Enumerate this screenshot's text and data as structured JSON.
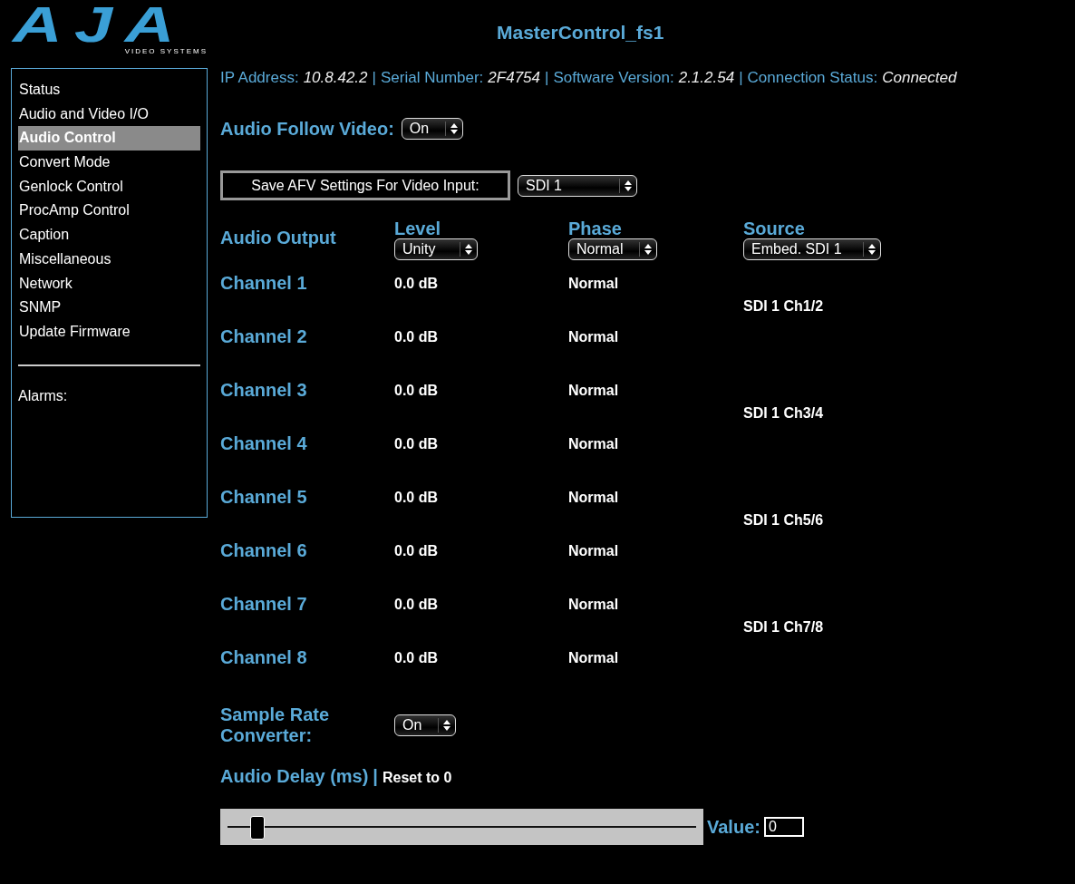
{
  "logo": {
    "mark": "AJA",
    "tagline": "VIDEO SYSTEMS"
  },
  "title": "MasterControl_fs1",
  "sidebar": {
    "items": [
      {
        "label": "Status",
        "selected": false
      },
      {
        "label": "Audio and Video I/O",
        "selected": false
      },
      {
        "label": "Audio Control",
        "selected": true
      },
      {
        "label": "Convert Mode",
        "selected": false
      },
      {
        "label": "Genlock Control",
        "selected": false
      },
      {
        "label": "ProcAmp Control",
        "selected": false
      },
      {
        "label": "Caption",
        "selected": false
      },
      {
        "label": "Miscellaneous",
        "selected": false
      },
      {
        "label": "Network",
        "selected": false
      },
      {
        "label": "SNMP",
        "selected": false
      },
      {
        "label": "Update Firmware",
        "selected": false
      }
    ],
    "alarms_label": "Alarms:"
  },
  "info": [
    {
      "kind": "field",
      "label": "IP Address:",
      "value": "10.8.42.2"
    },
    {
      "kind": "sep",
      "text": "|"
    },
    {
      "kind": "field",
      "label": "Serial Number:",
      "value": "2F4754"
    },
    {
      "kind": "sep",
      "text": "|"
    },
    {
      "kind": "field",
      "label": "Software Version:",
      "value": "2.1.2.54"
    },
    {
      "kind": "sep",
      "text": "|"
    },
    {
      "kind": "field",
      "label": "Connection Status:",
      "value": "Connected"
    }
  ],
  "audio_follow_video": {
    "label": "Audio Follow Video:",
    "value": "On"
  },
  "save_afv": {
    "button": "Save AFV Settings For Video Input:",
    "value": "SDI 1"
  },
  "audio_output": {
    "label": "Audio Output",
    "columns": [
      {
        "heading": "Level",
        "value": "Unity"
      },
      {
        "heading": "Phase",
        "value": "Normal"
      },
      {
        "heading": "Source",
        "value": "Embed. SDI 1"
      }
    ]
  },
  "channels": [
    {
      "name": "Channel 1",
      "level": "0.0 dB",
      "phase": "Normal"
    },
    {
      "name": "Channel 2",
      "level": "0.0 dB",
      "phase": "Normal"
    },
    {
      "name": "Channel 3",
      "level": "0.0 dB",
      "phase": "Normal"
    },
    {
      "name": "Channel 4",
      "level": "0.0 dB",
      "phase": "Normal"
    },
    {
      "name": "Channel 5",
      "level": "0.0 dB",
      "phase": "Normal"
    },
    {
      "name": "Channel 6",
      "level": "0.0 dB",
      "phase": "Normal"
    },
    {
      "name": "Channel 7",
      "level": "0.0 dB",
      "phase": "Normal"
    },
    {
      "name": "Channel 8",
      "level": "0.0 dB",
      "phase": "Normal"
    }
  ],
  "sources": [
    "SDI 1 Ch1/2",
    "SDI 1 Ch3/4",
    "SDI 1 Ch5/6",
    "SDI 1 Ch7/8"
  ],
  "sample_rate_converter": {
    "label": "Sample Rate Converter:",
    "value": "On"
  },
  "audio_delay": {
    "label": "Audio Delay (ms)",
    "separator": "|",
    "reset": "Reset to 0",
    "level": 0.06,
    "value_label": "Value:",
    "value": "0"
  }
}
